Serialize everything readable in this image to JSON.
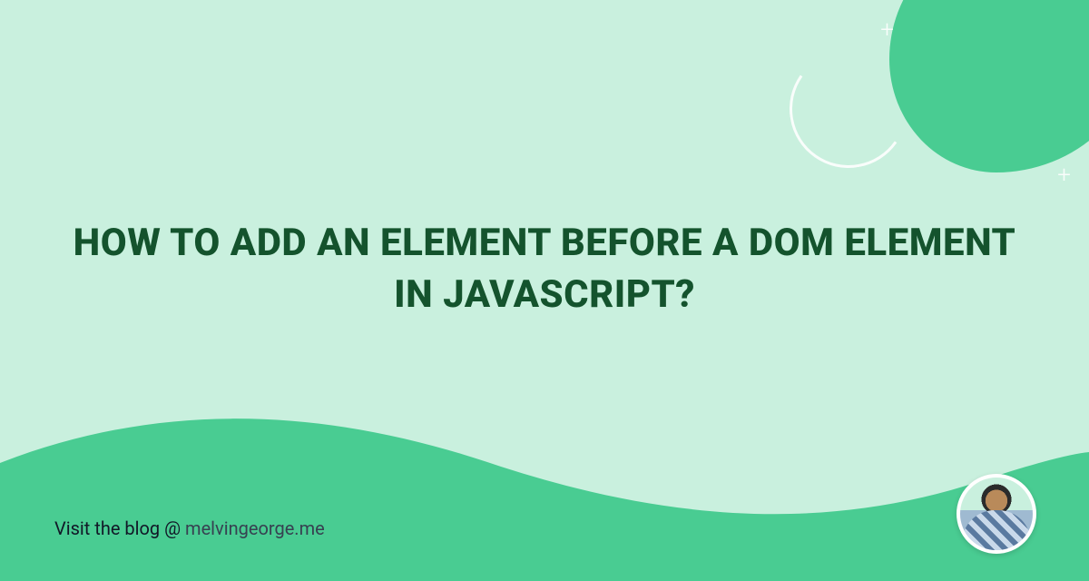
{
  "headline": "HOW TO ADD AN ELEMENT BEFORE A DOM ELEMENT IN JAVASCRIPT?",
  "footer": {
    "prefix": "Visit the blog @ ",
    "site": "melvingeorge.me"
  },
  "colors": {
    "bg": "#c9f0de",
    "accent": "#49cc92",
    "heading": "#14532d"
  }
}
